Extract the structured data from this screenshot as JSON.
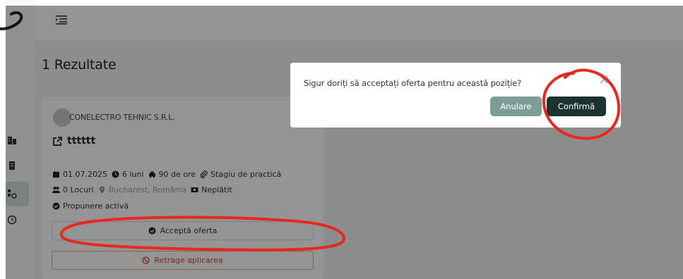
{
  "results": {
    "title": "1 Rezultate"
  },
  "card": {
    "company": "CONELECTRO TEHNIC S.R.L.",
    "job_title": "tttttt",
    "start_date": "01.07.2025",
    "duration": "6 luni",
    "hours": "90 de ore",
    "type": "Stagiu de practică",
    "places": "0 Locuri",
    "location": "Bucharest, România",
    "payment": "Neplătit",
    "status": "Propunere activă",
    "accept_label": "Acceptă oferta",
    "withdraw_label": "Retrage aplicarea"
  },
  "modal": {
    "message": "Sigur doriți să acceptați oferta pentru această poziție?",
    "cancel_label": "Anulare",
    "confirm_label": "Confirmă"
  },
  "colors": {
    "accent": "#1c3430",
    "cancel": "#7c9e95",
    "danger": "#cc4b3f",
    "annotation": "#e8281c"
  },
  "icons": {
    "logo": "logo-icon",
    "menu": "menu-toggle-icon",
    "calendar": "calendar-icon",
    "clock": "clock-icon",
    "car": "car-icon",
    "paperclip": "paperclip-icon",
    "people": "people-icon",
    "location": "location-pin-icon",
    "money": "money-icon",
    "check": "check-circle-icon",
    "ban": "ban-icon",
    "external": "external-link-icon",
    "close": "close-icon"
  }
}
